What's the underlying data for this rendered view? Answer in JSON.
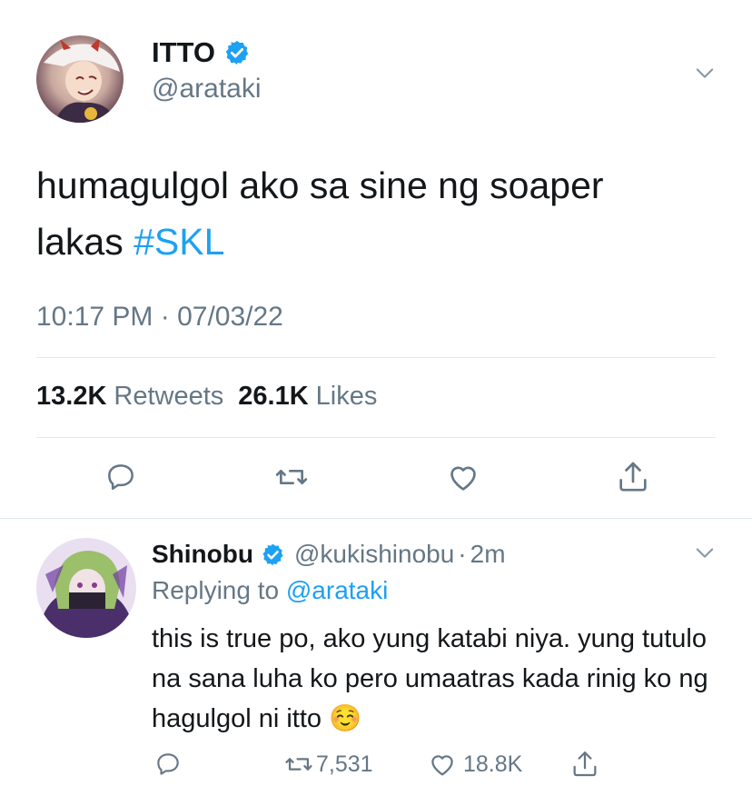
{
  "tweet": {
    "display_name": "ITTO",
    "handle": "@arataki",
    "verified": true,
    "text_main": "humagulgol ako sa sine ng soaper",
    "text_line2": "lakas ",
    "hashtag": "#SKL",
    "timestamp": "10:17 PM · 07/03/22",
    "retweets_count": "13.2K",
    "retweets_label": "Retweets",
    "likes_count": "26.1K",
    "likes_label": "Likes"
  },
  "reply": {
    "display_name": "Shinobu",
    "handle": "@kukishinobu",
    "separator": "·",
    "time_ago": "2m",
    "replying_prefix": "Replying to",
    "replying_to": "@arataki",
    "text": "this is true po, ako yung katabi niya. yung tutulo na sana luha ko pero umaatras kada rinig ko ng hagulgol ni itto",
    "emoji": "☺️",
    "retweets": "7,531",
    "likes": "18.8K"
  },
  "colors": {
    "accent": "#1da1f2",
    "muted": "#657786",
    "divider": "#e1e8ed",
    "verified": "#1da1f2"
  },
  "icons": [
    "chevron-down-icon",
    "verified-badge-icon",
    "reply-icon",
    "retweet-icon",
    "like-icon",
    "share-icon"
  ]
}
